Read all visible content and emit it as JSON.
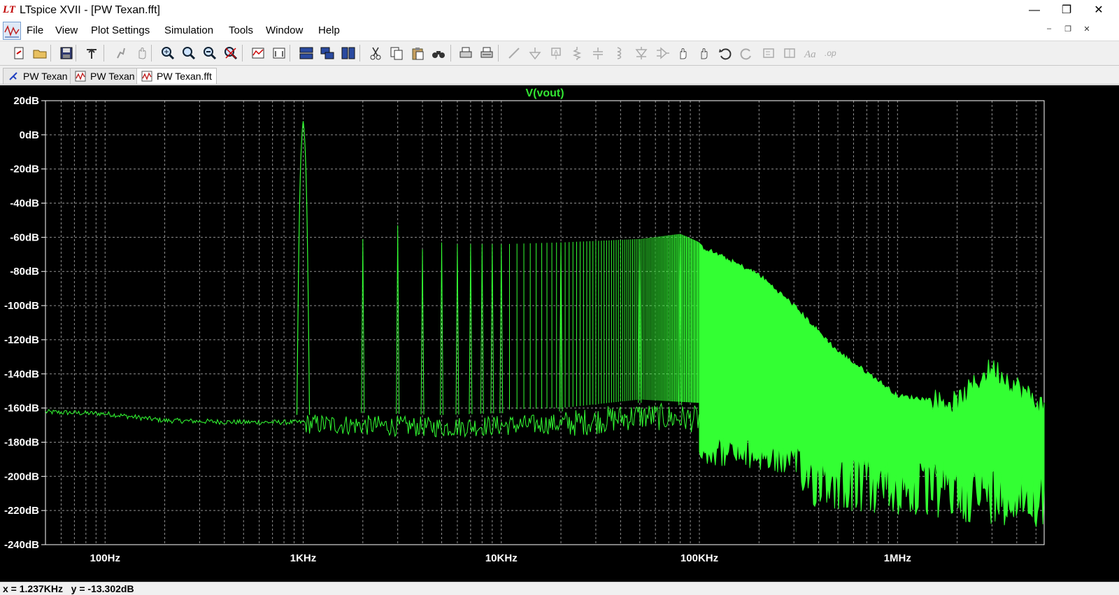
{
  "window": {
    "app_icon": "LT",
    "title": "LTspice XVII - [PW Texan.fft]",
    "minimize": "—",
    "maximize": "❐",
    "close": "✕"
  },
  "menu": {
    "items": [
      "File",
      "View",
      "Plot Settings",
      "Simulation",
      "Tools",
      "Window",
      "Help"
    ],
    "mdi_min": "–",
    "mdi_restore": "❐",
    "mdi_close": "✕"
  },
  "toolbar": {
    "icons": [
      "new-schematic-icon",
      "open-folder-icon",
      "save-icon",
      "control-panel-icon",
      "run-icon",
      "halt-icon",
      "zoom-area-icon",
      "zoom-in-icon",
      "zoom-out-icon",
      "zoom-fit-icon",
      "autorange-icon",
      "zoom-extents-icon",
      "tile-horizontal-icon",
      "cascade-icon",
      "tile-vertical-icon",
      "cut-icon",
      "copy-icon",
      "paste-icon",
      "find-icon",
      "print-icon",
      "print-preview-icon",
      "wire-icon",
      "ground-icon",
      "label-net-icon",
      "resistor-icon",
      "capacitor-icon",
      "inductor-icon",
      "diode-icon",
      "component-icon",
      "move-icon",
      "drag-icon",
      "undo-icon",
      "redo-icon",
      "rotate-icon",
      "mirror-icon",
      "text-icon",
      "spice-directive-icon"
    ]
  },
  "tabs": [
    {
      "label": "PW Texan",
      "icon": "schematic-icon"
    },
    {
      "label": "PW Texan",
      "icon": "waveform-icon"
    },
    {
      "label": "PW Texan.fft",
      "icon": "waveform-icon"
    }
  ],
  "colors": {
    "trace": "#33ff33",
    "trace_title": "#33e633",
    "grid": "#909090",
    "plot_bg": "#000000"
  },
  "chart_data": {
    "type": "line",
    "title": "V(vout)",
    "x_scale": "log",
    "x_range_hz": [
      50,
      5500000
    ],
    "y_range_db": [
      -240,
      20
    ],
    "x_ticks": [
      {
        "label": "100Hz",
        "value": 100
      },
      {
        "label": "1KHz",
        "value": 1000
      },
      {
        "label": "10KHz",
        "value": 10000
      },
      {
        "label": "100KHz",
        "value": 100000
      },
      {
        "label": "1MHz",
        "value": 1000000
      }
    ],
    "y_ticks": [
      {
        "label": "20dB",
        "value": 20
      },
      {
        "label": "0dB",
        "value": 0
      },
      {
        "label": "-20dB",
        "value": -20
      },
      {
        "label": "-40dB",
        "value": -40
      },
      {
        "label": "-60dB",
        "value": -60
      },
      {
        "label": "-80dB",
        "value": -80
      },
      {
        "label": "-100dB",
        "value": -100
      },
      {
        "label": "-120dB",
        "value": -120
      },
      {
        "label": "-140dB",
        "value": -140
      },
      {
        "label": "-160dB",
        "value": -160
      },
      {
        "label": "-180dB",
        "value": -180
      },
      {
        "label": "-200dB",
        "value": -200
      },
      {
        "label": "-220dB",
        "value": -220
      },
      {
        "label": "-240dB",
        "value": -240
      }
    ],
    "grid": true,
    "series": [
      {
        "name": "V(vout)",
        "fundamental": {
          "freq_hz": 1000,
          "level_db": 8
        },
        "harmonics": [
          {
            "freq_hz": 2000,
            "level_db": -61
          },
          {
            "freq_hz": 3000,
            "level_db": -53
          },
          {
            "freq_hz": 4000,
            "level_db": -67
          },
          {
            "freq_hz": 5000,
            "level_db": -63
          },
          {
            "freq_hz": 6000,
            "level_db": -64
          },
          {
            "freq_hz": 7000,
            "level_db": -64
          },
          {
            "freq_hz": 8000,
            "level_db": -64
          },
          {
            "freq_hz": 9000,
            "level_db": -64
          },
          {
            "freq_hz": 10000,
            "level_db": -64
          },
          {
            "freq_hz": 20000,
            "level_db": -63
          },
          {
            "freq_hz": 50000,
            "level_db": -61
          },
          {
            "freq_hz": 80000,
            "level_db": -58
          }
        ],
        "noise_floor": [
          {
            "freq_hz": 50,
            "level_db": -162
          },
          {
            "freq_hz": 100,
            "level_db": -163
          },
          {
            "freq_hz": 200,
            "level_db": -167
          },
          {
            "freq_hz": 500,
            "level_db": -168
          },
          {
            "freq_hz": 1000,
            "level_db": -168
          },
          {
            "freq_hz": 5000,
            "level_db": -170
          },
          {
            "freq_hz": 20000,
            "level_db": -168
          },
          {
            "freq_hz": 50000,
            "level_db": -163
          },
          {
            "freq_hz": 100000,
            "level_db": -165
          },
          {
            "freq_hz": 300000,
            "level_db": -172
          },
          {
            "freq_hz": 1000000,
            "level_db": -180
          },
          {
            "freq_hz": 5500000,
            "level_db": -185
          }
        ],
        "envelope": [
          {
            "freq_hz": 100000,
            "level_db": -65
          },
          {
            "freq_hz": 200000,
            "level_db": -82
          },
          {
            "freq_hz": 300000,
            "level_db": -100
          },
          {
            "freq_hz": 500000,
            "level_db": -127
          },
          {
            "freq_hz": 800000,
            "level_db": -144
          },
          {
            "freq_hz": 1000000,
            "level_db": -153
          },
          {
            "freq_hz": 2000000,
            "level_db": -157
          },
          {
            "freq_hz": 3000000,
            "level_db": -136
          },
          {
            "freq_hz": 5500000,
            "level_db": -160
          }
        ]
      }
    ]
  },
  "status": {
    "text": "x = 1.237KHz   y = -13.302dB"
  }
}
